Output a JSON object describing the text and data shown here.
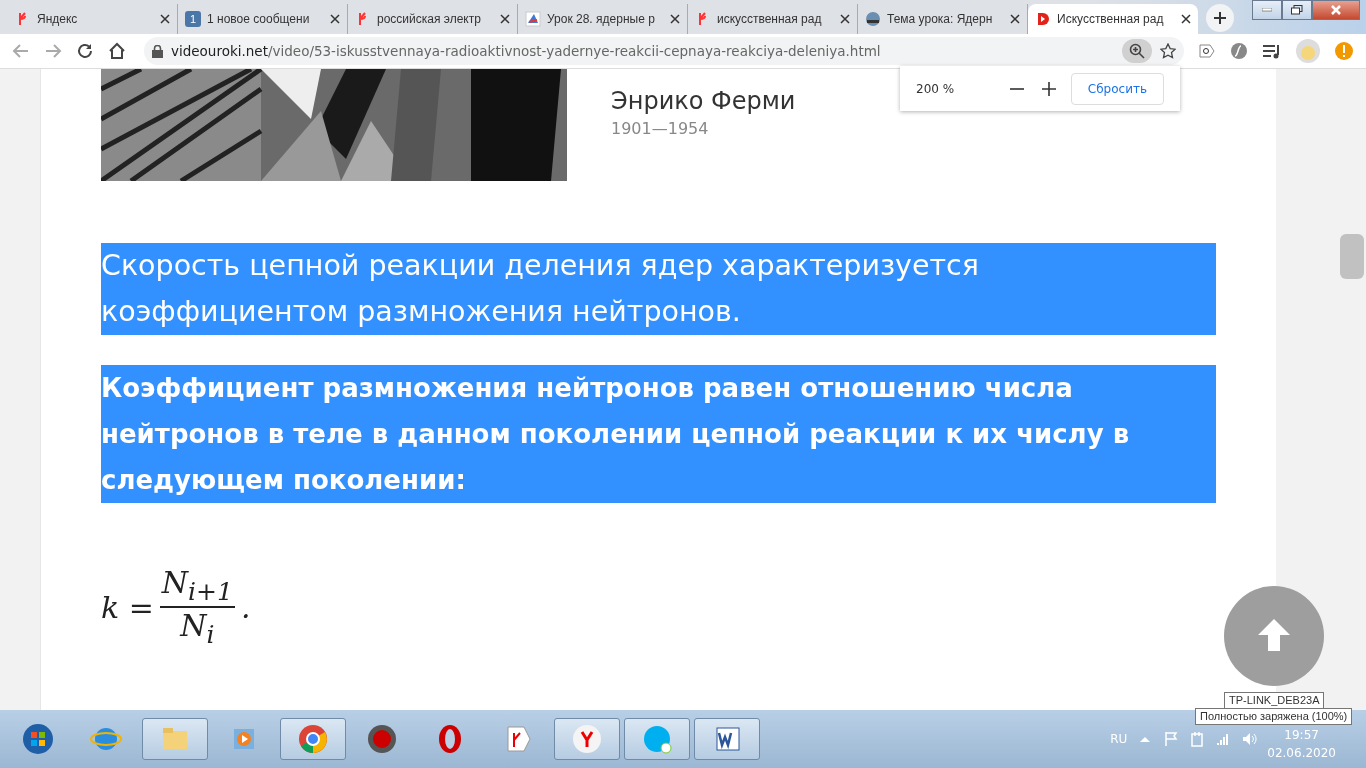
{
  "tabs": [
    {
      "title": "Яндекс",
      "selected": false
    },
    {
      "title": "1 новое сообщени",
      "selected": false
    },
    {
      "title": "российская электр",
      "selected": false
    },
    {
      "title": "Урок 28. ядерные р",
      "selected": false
    },
    {
      "title": "искусственная рад",
      "selected": false
    },
    {
      "title": "Тема урока: Ядерн",
      "selected": false
    },
    {
      "title": "Искусственная рад",
      "selected": true
    }
  ],
  "tab_badge": "1",
  "address": {
    "host": "videouroki.net",
    "path": "/video/53-iskusstvennaya-radioaktivnost-yadernye-reakcii-cepnaya-reakciya-deleniya.html"
  },
  "zoom_popup": {
    "value": "200 %",
    "reset": "Сбросить"
  },
  "banner": {
    "kind": "picture",
    "name": "Энрико Ферми",
    "years": "1901—1954"
  },
  "paragraphs": [
    {
      "text": "Скорость цепной реакции деления ядер характеризуется коэффициентом размножения нейтронов.",
      "bold": false,
      "selected": true
    },
    {
      "text": "Коэффициент размножения нейтронов равен отношению числа нейтронов в теле в данном поколении цепной реакции к их числу в следующем поколении:",
      "bold": true,
      "selected": true
    }
  ],
  "formula": {
    "lhs": "k =",
    "numerator": "N$_{i+1}$",
    "denominator": "N$_{i}$",
    "end": "."
  },
  "tooltips": [
    "TP-LINK_DEB23A",
    "Полностью заряжена (100%)"
  ],
  "tray": {
    "language": "RU",
    "time": "19:57",
    "date": "02.06.2020"
  }
}
